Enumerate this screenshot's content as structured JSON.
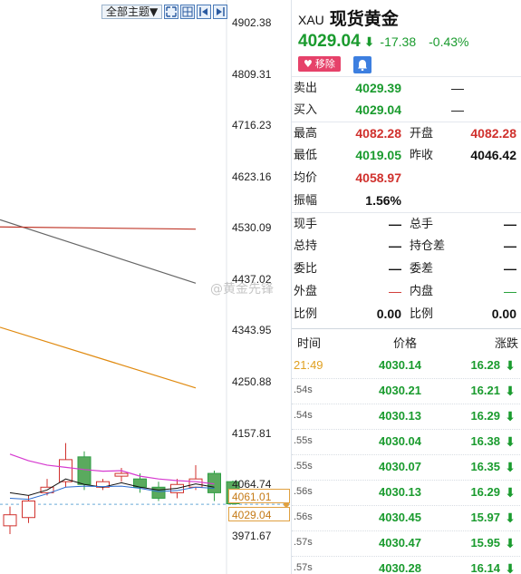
{
  "toolbar": {
    "theme_label": "全部主题▼",
    "icons": [
      "expand-icon",
      "grid-icon",
      "prev-icon",
      "next-icon"
    ]
  },
  "axis": {
    "price_labels": [
      "4902.38",
      "4809.31",
      "4716.23",
      "4623.16",
      "4530.09",
      "4437.02",
      "4343.95",
      "4250.88",
      "4157.81",
      "4064.74",
      "3971.67"
    ],
    "tag_high": "4061.01",
    "tag_current": "4029.04"
  },
  "chart_data": {
    "type": "candlestick",
    "ylim": [
      3950,
      4920
    ],
    "candles": [
      {
        "open": 3990,
        "close": 4010,
        "high": 4025,
        "low": 3975,
        "dir": "up"
      },
      {
        "open": 4005,
        "close": 4035,
        "high": 4045,
        "low": 3995,
        "dir": "up"
      },
      {
        "open": 4050,
        "close": 4060,
        "high": 4075,
        "low": 4045,
        "dir": "up"
      },
      {
        "open": 4070,
        "close": 4110,
        "high": 4140,
        "low": 4060,
        "dir": "up"
      },
      {
        "open": 4115,
        "close": 4065,
        "high": 4125,
        "low": 4055,
        "dir": "down"
      },
      {
        "open": 4060,
        "close": 4070,
        "high": 4075,
        "low": 4055,
        "dir": "up"
      },
      {
        "open": 4080,
        "close": 4085,
        "high": 4095,
        "low": 4070,
        "dir": "up"
      },
      {
        "open": 4075,
        "close": 4060,
        "high": 4085,
        "low": 4050,
        "dir": "down"
      },
      {
        "open": 4060,
        "close": 4040,
        "high": 4070,
        "low": 4035,
        "dir": "down"
      },
      {
        "open": 4065,
        "close": 4050,
        "high": 4075,
        "low": 4040,
        "dir": "up"
      },
      {
        "open": 4060,
        "close": 4075,
        "high": 4100,
        "low": 4055,
        "dir": "up"
      },
      {
        "open": 4085,
        "close": 4050,
        "high": 4090,
        "low": 4035,
        "dir": "down"
      },
      {
        "open": 4070,
        "close": 4030,
        "high": 4072,
        "low": 4028,
        "dir": "down"
      }
    ],
    "ma_lines": [
      {
        "name": "ma-gray",
        "color": "#666666",
        "points": [
          [
            4545,
            0
          ],
          [
            4430,
            1
          ]
        ]
      },
      {
        "name": "ma-red",
        "color": "#c0392b",
        "points": [
          [
            4532,
            0
          ],
          [
            4528,
            1
          ]
        ]
      },
      {
        "name": "ma-orange",
        "color": "#e08a10",
        "points": [
          [
            4350,
            0
          ],
          [
            4240,
            1
          ]
        ]
      }
    ],
    "current_price": 4029.04
  },
  "quote": {
    "symbol": "XAU",
    "name": "现货黄金",
    "last": "4029.04",
    "change": "-17.38",
    "change_pct": "-0.43%",
    "remove_label": "移除",
    "rows": [
      {
        "l1": "卖出",
        "v1": "4029.39",
        "c1": "green",
        "l2": "",
        "v2": "—",
        "c2": "black"
      },
      {
        "l1": "买入",
        "v1": "4029.04",
        "c1": "green",
        "l2": "",
        "v2": "—",
        "c2": "black"
      },
      {
        "l1": "最高",
        "v1": "4082.28",
        "c1": "red",
        "l2": "开盘",
        "v2": "4082.28",
        "c2": "red"
      },
      {
        "l1": "最低",
        "v1": "4019.05",
        "c1": "green",
        "l2": "昨收",
        "v2": "4046.42",
        "c2": "black"
      },
      {
        "l1": "均价",
        "v1": "4058.97",
        "c1": "red",
        "l2": "",
        "v2": "",
        "c2": "black"
      },
      {
        "l1": "振幅",
        "v1": "1.56%",
        "c1": "black",
        "l2": "",
        "v2": "",
        "c2": "black"
      },
      {
        "l1": "现手",
        "v1": "—",
        "c1": "black",
        "l2": "总手",
        "v2": "—",
        "c2": "black"
      },
      {
        "l1": "总持",
        "v1": "—",
        "c1": "black",
        "l2": "持仓差",
        "v2": "—",
        "c2": "black"
      },
      {
        "l1": "委比",
        "v1": "—",
        "c1": "black",
        "l2": "委差",
        "v2": "—",
        "c2": "black"
      },
      {
        "l1": "外盘",
        "v1": "—",
        "c1": "dash-red",
        "l2": "内盘",
        "v2": "—",
        "c2": "dash-green"
      },
      {
        "l1": "比例",
        "v1": "0.00",
        "c1": "black",
        "l2": "比例",
        "v2": "0.00",
        "c2": "black"
      }
    ]
  },
  "ticks": {
    "headers": {
      "time": "时间",
      "price": "价格",
      "change": "涨跌"
    },
    "rows": [
      {
        "time": "21:49",
        "price": "4030.14",
        "change": "16.28"
      },
      {
        "time": ".54s",
        "price": "4030.21",
        "change": "16.21"
      },
      {
        "time": ".54s",
        "price": "4030.13",
        "change": "16.29"
      },
      {
        "time": ".55s",
        "price": "4030.04",
        "change": "16.38"
      },
      {
        "time": ".55s",
        "price": "4030.07",
        "change": "16.35"
      },
      {
        "time": ".56s",
        "price": "4030.13",
        "change": "16.29"
      },
      {
        "time": ".56s",
        "price": "4030.45",
        "change": "15.97"
      },
      {
        "time": ".57s",
        "price": "4030.47",
        "change": "15.95"
      },
      {
        "time": ".57s",
        "price": "4030.28",
        "change": "16.14"
      }
    ]
  },
  "watermark": "@黄金先锋"
}
